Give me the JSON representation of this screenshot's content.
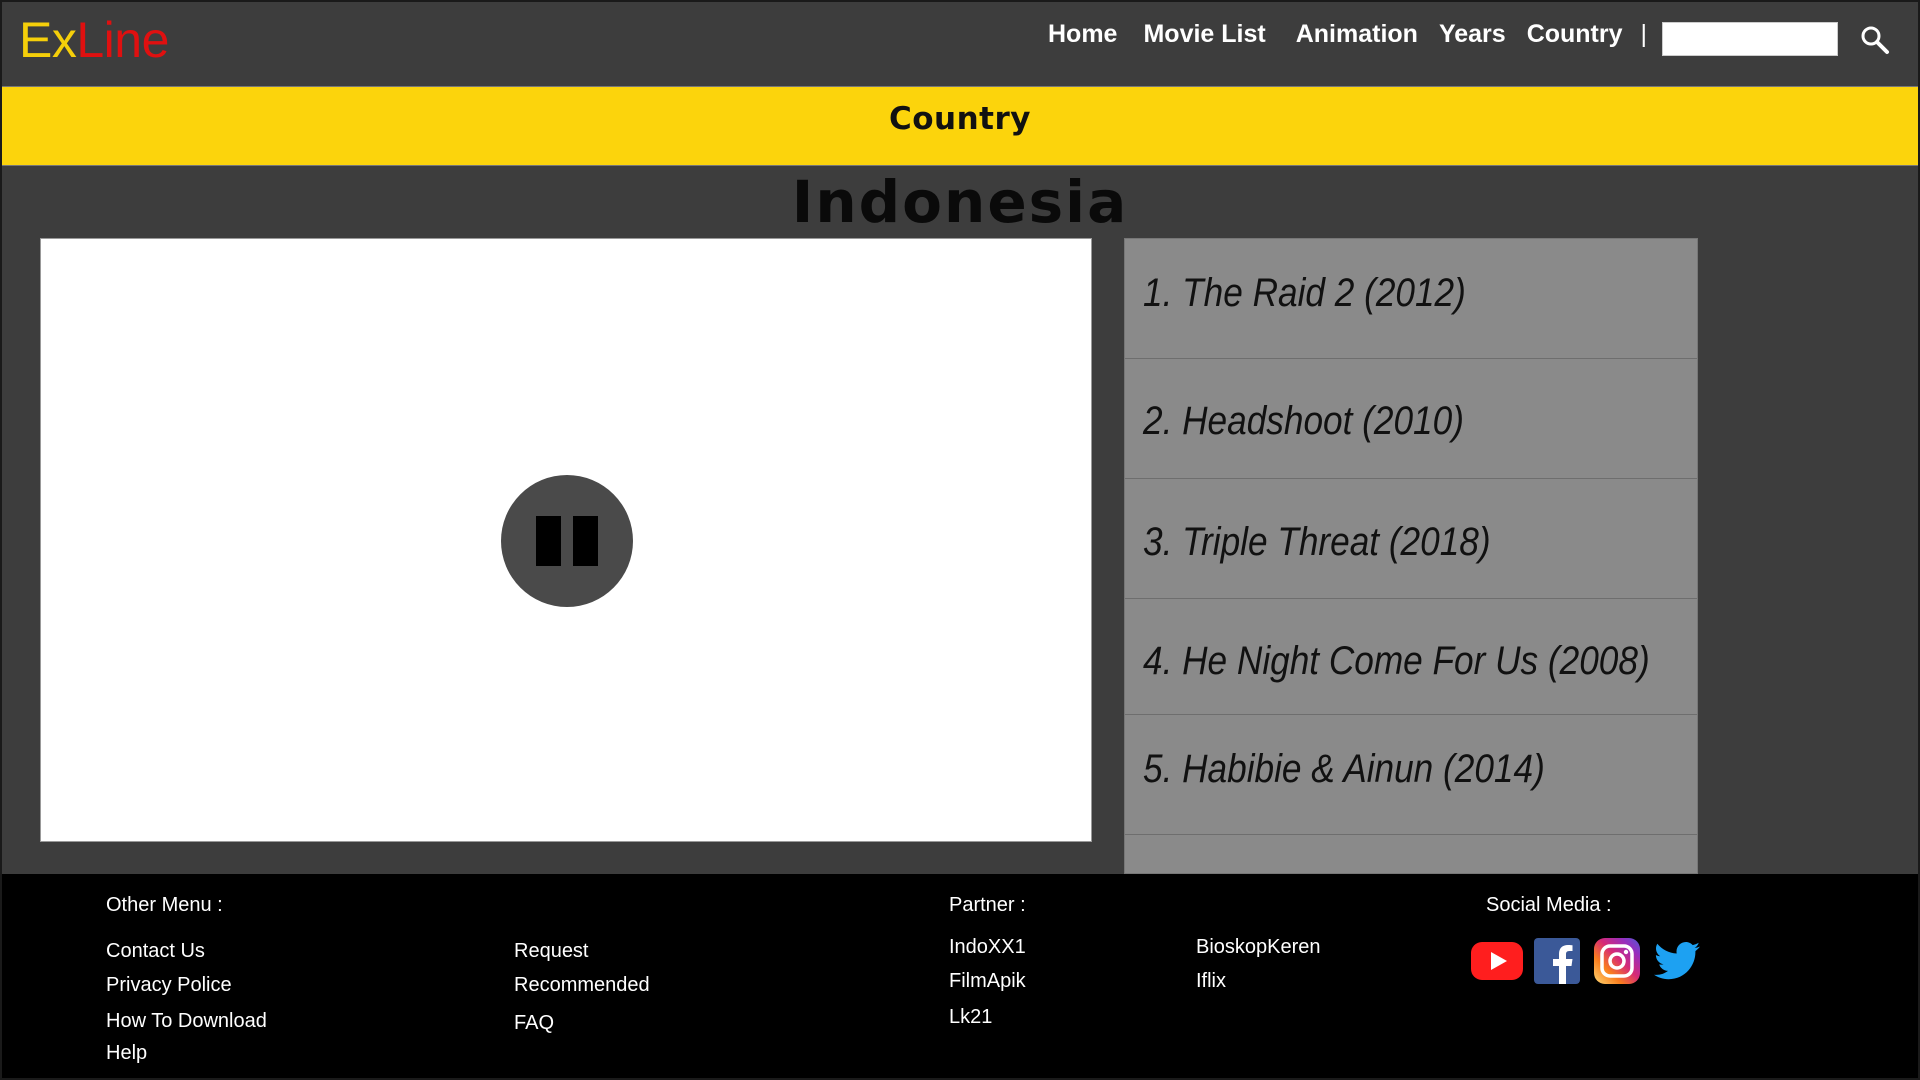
{
  "header": {
    "logo_ex": "Ex",
    "logo_line": "Line",
    "nav": [
      "Home",
      "Movie List",
      "Animation",
      "Years",
      "Country"
    ],
    "separator": "|",
    "search_placeholder": "",
    "search_icon": "search-icon"
  },
  "band": {
    "title": "Country"
  },
  "main": {
    "title": "Indonesia",
    "player": {
      "state_icon": "pause-icon"
    },
    "movies": [
      "1. The Raid 2 (2012)",
      "2. Headshoot (2010)",
      "3. Triple Threat (2018)",
      "4. He Night Come For Us (2008)",
      "5. Habibie & Ainun (2014)"
    ]
  },
  "footer": {
    "other_menu_label": "Other Menu :",
    "other_menu_col1": [
      "Contact Us",
      "Privacy Police",
      "How To Download",
      "Help"
    ],
    "other_menu_col2": [
      "Request",
      "Recommended",
      "FAQ"
    ],
    "partner_label": "Partner :",
    "partner_col1": [
      "IndoXX1",
      "FilmApik",
      "Lk21"
    ],
    "partner_col2": [
      "BioskopKeren",
      "Iflix"
    ],
    "social_label": "Social Media :",
    "social_icons": [
      "youtube-icon",
      "facebook-icon",
      "instagram-icon",
      "twitter-icon"
    ]
  },
  "colors": {
    "logo_ex": "#f5cf0a",
    "logo_line": "#e01010",
    "band": "#fcd40c",
    "background": "#3d3d3d",
    "list": "#8a8a8a",
    "footer": "#000000"
  }
}
